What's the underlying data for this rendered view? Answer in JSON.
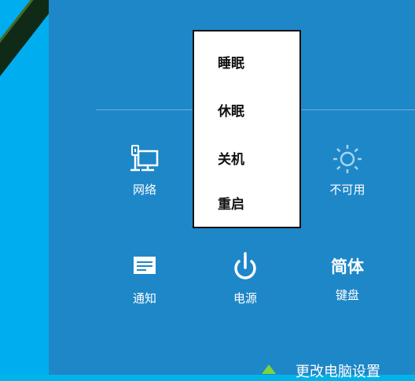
{
  "charms": {
    "network_label": "网络",
    "brightness_label": "不可用",
    "notifications_label": "通知",
    "power_label": "电源",
    "keyboard_title": "简体",
    "keyboard_label": "键盘",
    "change_settings_label": "更改电脑设置"
  },
  "power_menu": {
    "items": [
      "睡眠",
      "休眠",
      "关机",
      "重启"
    ]
  },
  "colors": {
    "panel": "#1e87c8",
    "desktop": "#00aef0",
    "menu_bg": "#ffffff"
  }
}
